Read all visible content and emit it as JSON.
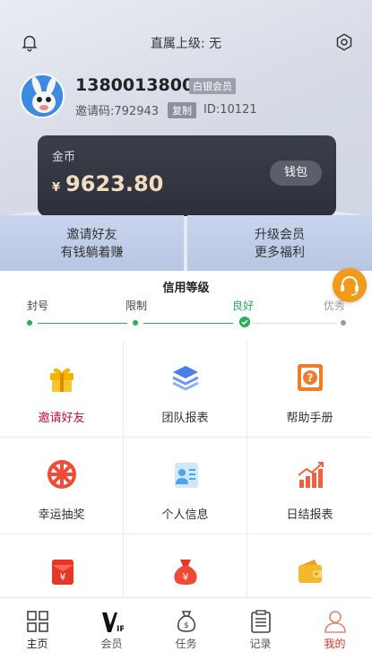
{
  "header": {
    "superior_text": "直属上级: 无"
  },
  "user": {
    "phone": "13800138000",
    "level_badge": "白银会员",
    "invite_label": "邀请码:792943",
    "copy_label": "复制",
    "id_label": "ID:10121"
  },
  "gold": {
    "label": "金币",
    "currency": "¥",
    "amount": "9623.80",
    "wallet_button": "钱包"
  },
  "promos": [
    {
      "line1": "邀请好友",
      "line2": "有钱躺着赚"
    },
    {
      "line1": "升级会员",
      "line2": "更多福利"
    }
  ],
  "credit": {
    "title": "信用等级",
    "steps": [
      "封号",
      "限制",
      "良好",
      "优秀"
    ],
    "current_step": "良好",
    "active_color": "#27b05a"
  },
  "menu": [
    {
      "label": "邀请好友",
      "icon": "gift-icon",
      "color": "#c8102e"
    },
    {
      "label": "团队报表",
      "icon": "layers-icon"
    },
    {
      "label": "帮助手册",
      "icon": "help-book-icon"
    },
    {
      "label": "幸运抽奖",
      "icon": "lucky-wheel-icon"
    },
    {
      "label": "个人信息",
      "icon": "id-card-icon"
    },
    {
      "label": "日结报表",
      "icon": "bar-chart-icon"
    },
    {
      "label": "",
      "icon": "red-envelope-icon"
    },
    {
      "label": "",
      "icon": "money-bag-icon"
    },
    {
      "label": "",
      "icon": "wallet-icon"
    }
  ],
  "tabs": [
    {
      "label": "主页",
      "icon": "home-grid-icon"
    },
    {
      "label": "会员",
      "icon": "vip-icon"
    },
    {
      "label": "任务",
      "icon": "money-bag-task-icon"
    },
    {
      "label": "记录",
      "icon": "clipboard-icon"
    },
    {
      "label": "我的",
      "icon": "user-icon",
      "active": true,
      "color": "#d9342b"
    }
  ]
}
